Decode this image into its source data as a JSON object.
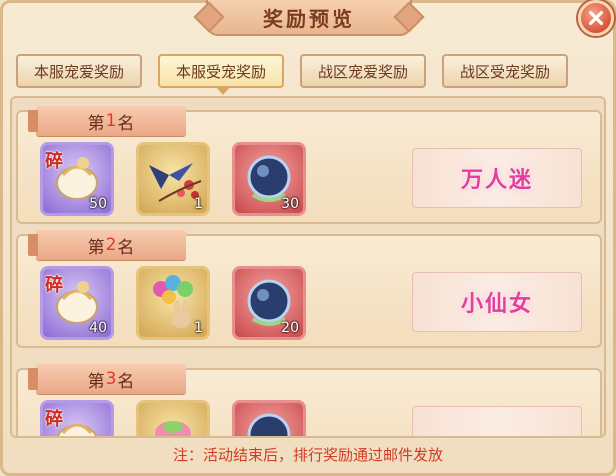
{
  "window": {
    "title": "奖励预览"
  },
  "tabs": [
    {
      "label": "本服宠爱奖励",
      "active": false
    },
    {
      "label": "本服受宠奖励",
      "active": true
    },
    {
      "label": "战区宠爱奖励",
      "active": false
    },
    {
      "label": "战区受宠奖励",
      "active": false
    }
  ],
  "ranks": [
    {
      "prefix": "第",
      "number": "1",
      "suffix": "名",
      "items": [
        {
          "icon": "shard-egg-icon",
          "shard_label": "碎",
          "count": "50",
          "rarity": "purple"
        },
        {
          "icon": "swallow-blossom-icon",
          "count": "1",
          "rarity": "gold"
        },
        {
          "icon": "butterfly-orb-icon",
          "count": "30",
          "rarity": "red"
        }
      ],
      "title_reward": "万人迷"
    },
    {
      "prefix": "第",
      "number": "2",
      "suffix": "名",
      "items": [
        {
          "icon": "shard-egg-icon",
          "shard_label": "碎",
          "count": "40",
          "rarity": "purple"
        },
        {
          "icon": "balloon-bunny-icon",
          "count": "1",
          "rarity": "gold"
        },
        {
          "icon": "butterfly-orb-icon",
          "count": "20",
          "rarity": "red"
        }
      ],
      "title_reward": "小仙女"
    },
    {
      "prefix": "第",
      "number": "3",
      "suffix": "名",
      "items": [
        {
          "icon": "shard-egg-icon",
          "shard_label": "碎",
          "count": "",
          "rarity": "purple"
        },
        {
          "icon": "gift-icon",
          "count": "",
          "rarity": "gold"
        },
        {
          "icon": "butterfly-orb-icon",
          "count": "",
          "rarity": "red"
        }
      ],
      "title_reward": ""
    }
  ],
  "footer": {
    "note": "注：活动结束后，排行奖励通过邮件发放"
  },
  "colors": {
    "accent_red": "#e03a2a",
    "title_pink": "#e0409a",
    "panel_bg": "#f3e2c6"
  }
}
